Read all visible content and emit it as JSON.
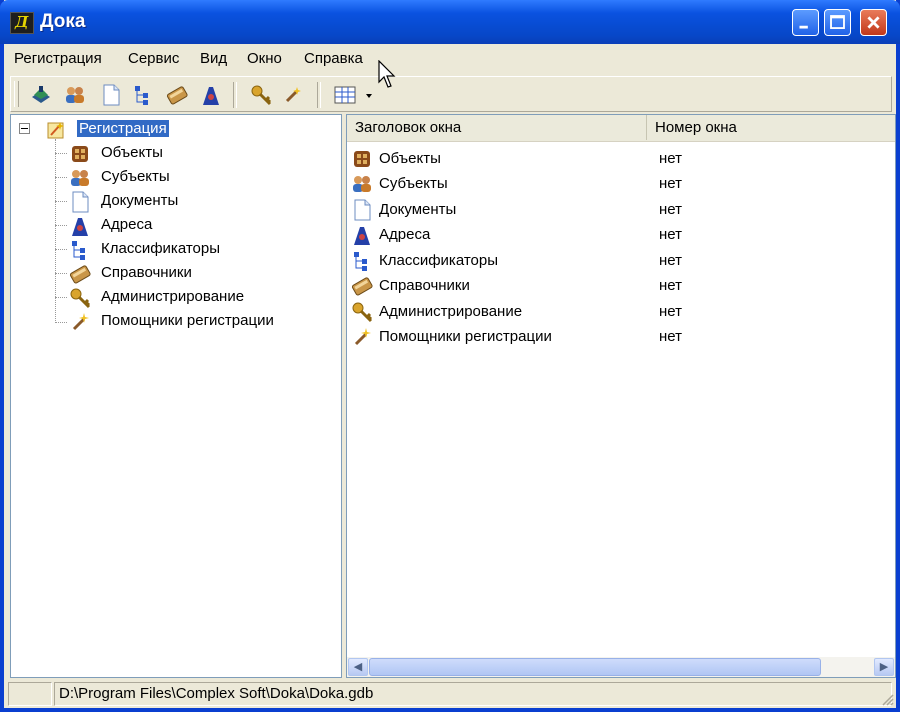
{
  "window": {
    "title": "Дока"
  },
  "menu": [
    "Регистрация",
    "Сервис",
    "Вид",
    "Окно",
    "Справка"
  ],
  "toolbar": {
    "icons": [
      "registration-icon",
      "subjects-icon",
      "documents-icon",
      "classifiers-icon",
      "references-icon",
      "addresses-icon",
      "administration-icon",
      "wizards-icon",
      "view-grid-icon"
    ]
  },
  "tree": {
    "root": "Регистрация",
    "children": [
      "Объекты",
      "Субъекты",
      "Документы",
      "Адреса",
      "Классификаторы",
      "Справочники",
      "Администрирование",
      "Помощники регистрации"
    ]
  },
  "list": {
    "columns": [
      "Заголовок окна",
      "Номер окна"
    ],
    "rows": [
      {
        "title": "Объекты",
        "number": "нет",
        "icon": "objects-icon"
      },
      {
        "title": "Субъекты",
        "number": "нет",
        "icon": "subjects-icon"
      },
      {
        "title": "Документы",
        "number": "нет",
        "icon": "documents-icon"
      },
      {
        "title": "Адреса",
        "number": "нет",
        "icon": "addresses-icon"
      },
      {
        "title": "Классификаторы",
        "number": "нет",
        "icon": "classifiers-icon"
      },
      {
        "title": "Справочники",
        "number": "нет",
        "icon": "references-icon"
      },
      {
        "title": "Администрирование",
        "number": "нет",
        "icon": "administration-icon"
      },
      {
        "title": "Помощники регистрации",
        "number": "нет",
        "icon": "wizards-icon"
      }
    ]
  },
  "status": {
    "path": "D:\\Program Files\\Complex Soft\\Doka\\Doka.gdb"
  },
  "colors": {
    "titlebar": "#0a52e0",
    "selection": "#316ac5",
    "background": "#ece9d8"
  }
}
